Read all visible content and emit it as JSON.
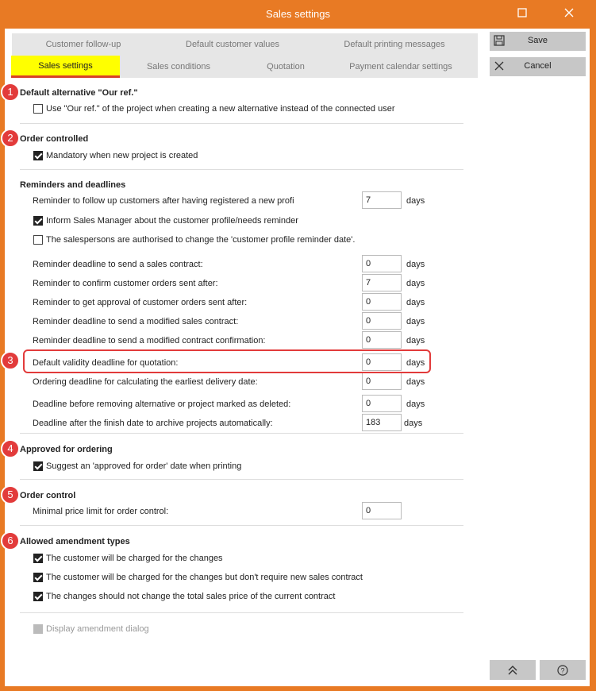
{
  "window": {
    "title": "Sales settings",
    "maximize_icon": "maximize-icon",
    "close_icon": "close-icon"
  },
  "tabs_row1": [
    "Customer follow-up",
    "Default customer values",
    "Default printing messages"
  ],
  "tabs_row2": [
    "Sales settings",
    "Sales conditions",
    "Quotation",
    "Payment calendar settings"
  ],
  "active_tab": "Sales settings",
  "actions": {
    "save": "Save",
    "cancel": "Cancel",
    "save_icon": "save-icon",
    "cancel_icon": "cancel-icon"
  },
  "badges": [
    "1",
    "2",
    "3",
    "4",
    "5",
    "6"
  ],
  "sections": {
    "our_ref": {
      "title": "Default alternative \"Our ref.\"",
      "option": "Use \"Our ref.\" of the project when creating a new alternative instead of the connected user",
      "checked": false
    },
    "order_controlled": {
      "title": "Order controlled",
      "option": "Mandatory when new project is created",
      "checked": true
    },
    "reminders": {
      "title": "Reminders and deadlines",
      "follow_up_label": "Reminder to follow up customers after having registered a new profi",
      "follow_up_value": "7",
      "inform_manager": "Inform Sales Manager about the customer profile/needs reminder",
      "inform_manager_checked": true,
      "authorised": "The salespersons are authorised to change the 'customer profile reminder date'.",
      "authorised_checked": false,
      "rows": [
        {
          "label": "Reminder deadline to send a sales contract:",
          "value": "0",
          "unit": "days"
        },
        {
          "label": "Reminder to confirm customer orders sent after:",
          "value": "7",
          "unit": "days"
        },
        {
          "label": "Reminder to get approval of customer orders sent after:",
          "value": "0",
          "unit": "days"
        },
        {
          "label": "Reminder deadline to send a modified sales contract:",
          "value": "0",
          "unit": "days"
        },
        {
          "label": "Reminder deadline to send a modified contract confirmation:",
          "value": "0",
          "unit": "days"
        },
        {
          "label": "Default validity deadline for quotation:",
          "value": "0",
          "unit": "days"
        },
        {
          "label": "Ordering deadline for calculating the earliest delivery date:",
          "value": "0",
          "unit": "days"
        },
        {
          "label": "Deadline before removing alternative or project marked as deleted:",
          "value": "0",
          "unit": "days"
        },
        {
          "label": "Deadline after the finish date to archive projects automatically:",
          "value": "183",
          "unit": "days"
        }
      ],
      "days": "days"
    },
    "approved": {
      "title": "Approved for ordering",
      "option": "Suggest an 'approved for order' date when printing",
      "checked": true
    },
    "order_control": {
      "title": "Order control",
      "label": "Minimal price limit for order control:",
      "value": "0"
    },
    "amendment": {
      "title": "Allowed amendment types",
      "options": [
        {
          "label": "The customer will be charged for the changes",
          "checked": true
        },
        {
          "label": "The customer will be charged for the changes but don't require new sales contract",
          "checked": true
        },
        {
          "label": "The changes should not change the total sales price of the current contract",
          "checked": true
        }
      ],
      "display_dialog": "Display amendment dialog",
      "display_dialog_checked": true
    }
  },
  "footer": {
    "scroll_top_icon": "double-chevron-up-icon",
    "help_icon": "help-icon"
  },
  "colors": {
    "frame": "#e87a24",
    "active_tab": "#ffff00",
    "tab_underline": "#d8402a",
    "badge": "#e23b3b"
  }
}
